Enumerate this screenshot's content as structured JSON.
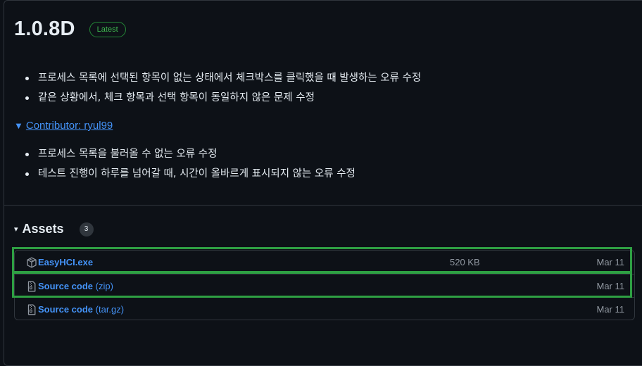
{
  "release": {
    "title": "1.0.8D",
    "badge": "Latest"
  },
  "notes_primary": [
    "프로세스 목록에 선택된 항목이 없는 상태에서 체크박스를 클릭했을 때 발생하는 오류 수정",
    "같은 상황에서, 체크 항목과 선택 항목이 동일하지 않은 문제 수정"
  ],
  "contributor": {
    "toggle": "▼",
    "label": "Contributor: ryul99"
  },
  "notes_contributor": [
    "프로세스 목록을 불러올 수 없는 오류 수정",
    "테스트 진행이 하루를 넘어갈 때, 시간이 올바르게 표시되지 않는 오류 수정"
  ],
  "assets": {
    "toggle": "▾",
    "label": "Assets",
    "count": "3",
    "items": [
      {
        "name": "EasyHCI.exe",
        "suffix": "",
        "size": "520 KB",
        "date": "Mar 11",
        "icon": "package-icon"
      },
      {
        "name": "Source code",
        "suffix": " (zip)",
        "size": "",
        "date": "Mar 11",
        "icon": "file-zip-icon"
      },
      {
        "name": "Source code",
        "suffix": " (tar.gz)",
        "size": "",
        "date": "Mar 11",
        "icon": "file-zip-icon"
      }
    ]
  },
  "colors": {
    "background": "#0d1117",
    "link": "#4493f8",
    "latest_badge": "#3fb950",
    "highlight": "#2ea043",
    "muted": "#9198a1"
  }
}
